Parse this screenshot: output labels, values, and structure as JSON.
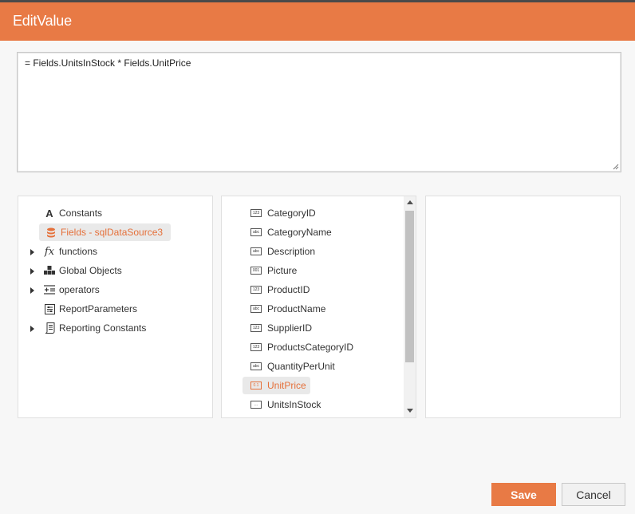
{
  "dialog": {
    "title": "EditValue"
  },
  "expression": {
    "value": "= Fields.UnitsInStock * Fields.UnitPrice"
  },
  "categories": [
    {
      "label": "Constants",
      "icon": "letter-a-icon",
      "expandable": false,
      "selected": false
    },
    {
      "label": "Fields - sqlDataSource3",
      "icon": "database-icon",
      "expandable": false,
      "selected": true
    },
    {
      "label": "functions",
      "icon": "fx-icon",
      "expandable": true,
      "selected": false
    },
    {
      "label": "Global Objects",
      "icon": "global-objects-icon",
      "expandable": true,
      "selected": false
    },
    {
      "label": "operators",
      "icon": "operators-icon",
      "expandable": true,
      "selected": false
    },
    {
      "label": "ReportParameters",
      "icon": "parameters-icon",
      "expandable": false,
      "selected": false
    },
    {
      "label": "Reporting Constants",
      "icon": "reporting-constants-icon",
      "expandable": true,
      "selected": false
    }
  ],
  "fields": [
    {
      "label": "CategoryID",
      "type_badge": "123",
      "selected": false
    },
    {
      "label": "CategoryName",
      "type_badge": "abc",
      "selected": false
    },
    {
      "label": "Description",
      "type_badge": "abc",
      "selected": false
    },
    {
      "label": "Picture",
      "type_badge": "001",
      "selected": false
    },
    {
      "label": "ProductID",
      "type_badge": "123",
      "selected": false
    },
    {
      "label": "ProductName",
      "type_badge": "abc",
      "selected": false
    },
    {
      "label": "SupplierID",
      "type_badge": "123",
      "selected": false
    },
    {
      "label": "ProductsCategoryID",
      "type_badge": "123",
      "selected": false
    },
    {
      "label": "QuantityPerUnit",
      "type_badge": "abc",
      "selected": false
    },
    {
      "label": "UnitPrice",
      "type_badge": "0.1",
      "selected": true
    },
    {
      "label": "UnitsInStock",
      "type_badge": "...",
      "selected": false
    }
  ],
  "buttons": {
    "save": "Save",
    "cancel": "Cancel"
  },
  "colors": {
    "accent": "#e87a45",
    "selected_text": "#e5703a",
    "selected_bg": "#e9e9e9"
  }
}
